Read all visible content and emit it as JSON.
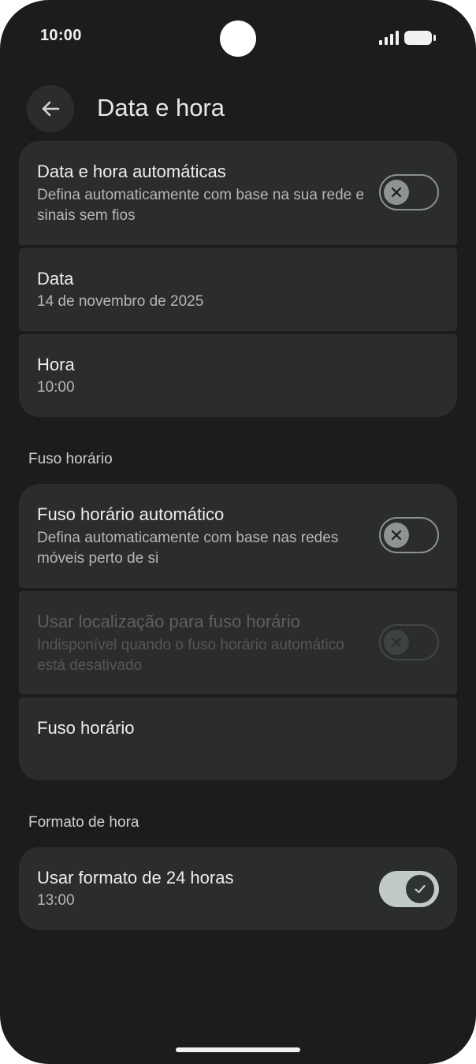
{
  "status_bar": {
    "time": "10:00",
    "signal_icon": "signal-bars-icon",
    "battery_icon": "battery-icon"
  },
  "header": {
    "back_icon": "arrow-back-icon",
    "title": "Data e hora"
  },
  "date_time_group": {
    "auto_date_time": {
      "title": "Data e hora automáticas",
      "subtitle": "Defina automaticamente com base na sua rede e sinais sem fios",
      "toggle_state": "off"
    },
    "date": {
      "title": "Data",
      "value": "14 de novembro de 2025"
    },
    "time": {
      "title": "Hora",
      "value": "10:00"
    }
  },
  "timezone_section": {
    "header": "Fuso horário",
    "auto_timezone": {
      "title": "Fuso horário automático",
      "subtitle": "Defina automaticamente com base nas redes móveis perto de si",
      "toggle_state": "off"
    },
    "use_location": {
      "title": "Usar localização para fuso horário",
      "subtitle": "Indisponível quando o fuso horário automático está desativado",
      "toggle_state": "off-disabled"
    },
    "timezone": {
      "title": "Fuso horário"
    }
  },
  "time_format_section": {
    "header": "Formato de hora",
    "use_24h": {
      "title": "Usar formato de 24 horas",
      "subtitle": "13:00",
      "toggle_state": "on"
    }
  },
  "colors": {
    "background": "#1b1c1c",
    "card": "#2b2c2c",
    "toggle_on_track": "#c2cac6",
    "toggle_on_knob": "#2e3432"
  }
}
